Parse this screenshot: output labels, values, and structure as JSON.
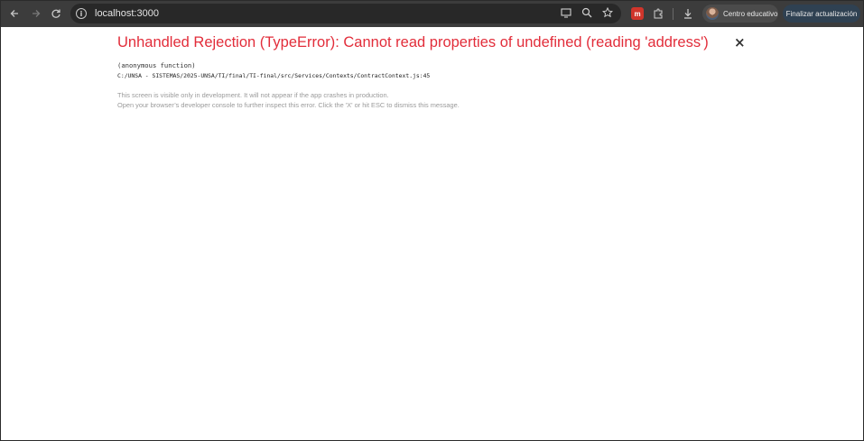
{
  "browser": {
    "url": "localhost:3000",
    "profile_label": "Centro educativo",
    "update_label": "Finalizar actualización",
    "icons": {
      "back": "arrow-left-icon",
      "forward": "arrow-right-icon",
      "reload": "reload-icon",
      "info": "info-icon",
      "cast": "cast-icon",
      "zoom": "zoom-icon",
      "bookmark": "star-icon",
      "extension_red": "red-extension-icon",
      "extensions": "puzzle-icon",
      "download": "download-icon",
      "menu": "kebab-menu-icon"
    }
  },
  "error": {
    "title": "Unhandled Rejection (TypeError): Cannot read properties of undefined (reading 'address')",
    "close_label": "×",
    "stack_function": "(anonymous function)",
    "stack_file": "C:/UNSA - SISTEMAS/2025-UNSA/TI/final/TI-final/src/Services/Contexts/ContractContext.js:45",
    "note_line1": "This screen is visible only in development. It will not appear if the app crashes in production.",
    "note_line2": "Open your browser’s developer console to further inspect this error.  Click the 'X' or hit ESC to dismiss this message."
  },
  "colors": {
    "error_red": "#e22d3a",
    "toolbar_bg": "#3c3c3c",
    "omnibox_bg": "#282828"
  }
}
